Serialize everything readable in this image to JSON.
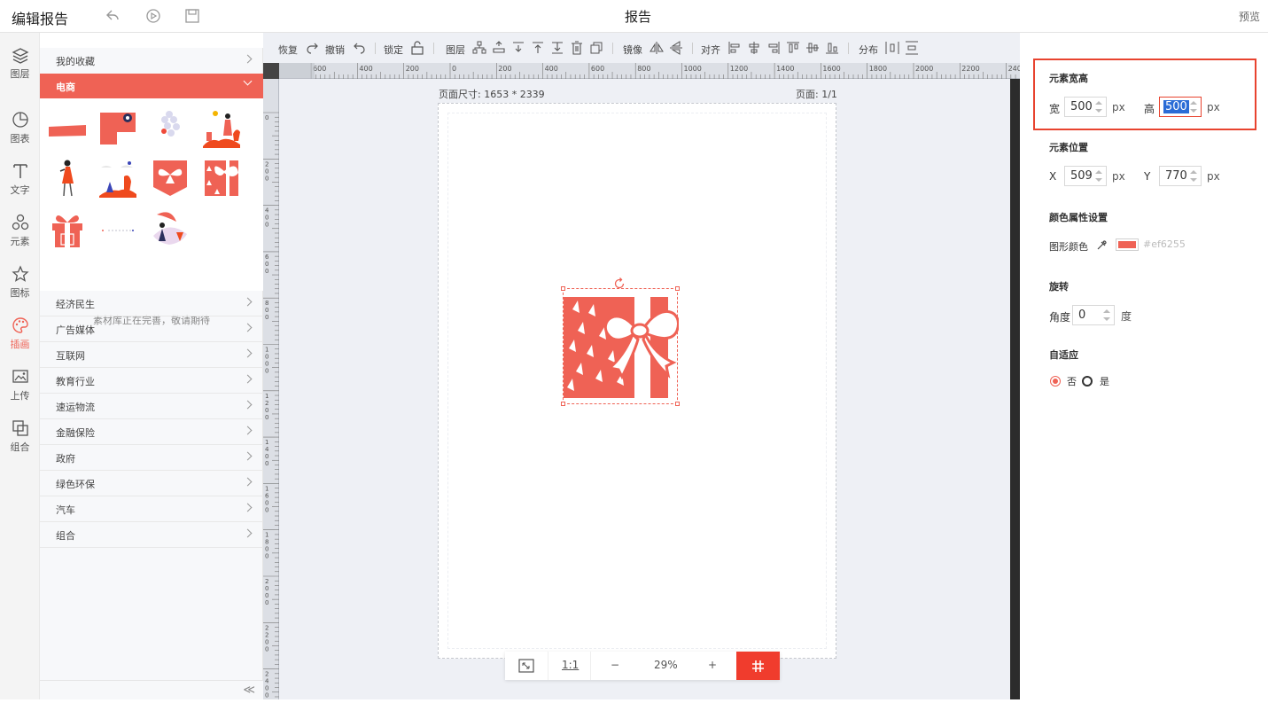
{
  "topbar": {
    "app_title": "编辑报告",
    "doc_title": "报告",
    "preview": "预览"
  },
  "rail": [
    {
      "label": "图层",
      "icon": "layers-icon"
    },
    {
      "label": "图表",
      "icon": "chart-icon"
    },
    {
      "label": "文字",
      "icon": "text-icon"
    },
    {
      "label": "元素",
      "icon": "shapes-icon"
    },
    {
      "label": "图标",
      "icon": "star-icon"
    },
    {
      "label": "插画",
      "icon": "palette-icon",
      "active": true
    },
    {
      "label": "上传",
      "icon": "upload-icon"
    },
    {
      "label": "组合",
      "icon": "group-icon"
    }
  ],
  "library": {
    "favorites": "我的收藏",
    "active_category": "电商",
    "note": "素材库正在完善，敬请期待",
    "categories": [
      "经济民生",
      "广告媒体",
      "互联网",
      "教育行业",
      "速运物流",
      "金融保险",
      "政府",
      "绿色环保",
      "汽车",
      "组合"
    ],
    "collapse": "≪"
  },
  "toolbar": {
    "redo": "恢复",
    "undo": "撤销",
    "lock": "锁定",
    "layer": "图层",
    "mirror": "镜像",
    "align": "对齐",
    "distribute": "分布"
  },
  "ruler": {
    "top_labels": [
      "600",
      "400",
      "200",
      "0",
      "200",
      "400",
      "600",
      "800",
      "1000",
      "1200",
      "1400",
      "1600",
      "1800",
      "2000",
      "2200",
      "2400"
    ],
    "left_labels": [
      "0",
      "200",
      "400",
      "600",
      "800",
      "1000",
      "1200",
      "1400",
      "1600",
      "1800",
      "2000",
      "2200",
      "2400"
    ]
  },
  "canvas": {
    "page_size": "页面尺寸: 1653 * 2339",
    "page_num": "页面: 1/1"
  },
  "zoom": {
    "fit": "⤢",
    "one_to_one": "1:1",
    "minus": "−",
    "value": "29%",
    "plus": "+"
  },
  "panel": {
    "size_title": "元素宽高",
    "width_label": "宽",
    "width": "500",
    "height_label": "高",
    "height": "500",
    "unit": "px",
    "pos_title": "元素位置",
    "x_label": "X",
    "x": "509",
    "y_label": "Y",
    "y": "770",
    "color_title": "颜色属性设置",
    "shape_color_label": "图形颜色",
    "color_hex": "#ef6255",
    "rotate_title": "旋转",
    "angle_label": "角度",
    "angle": "0",
    "angle_unit": "度",
    "adaptive_title": "自适应",
    "no": "否",
    "yes": "是"
  },
  "colors": {
    "accent": "#ef6255",
    "highlight": "#e8432f",
    "grid_button": "#f03c2d"
  }
}
